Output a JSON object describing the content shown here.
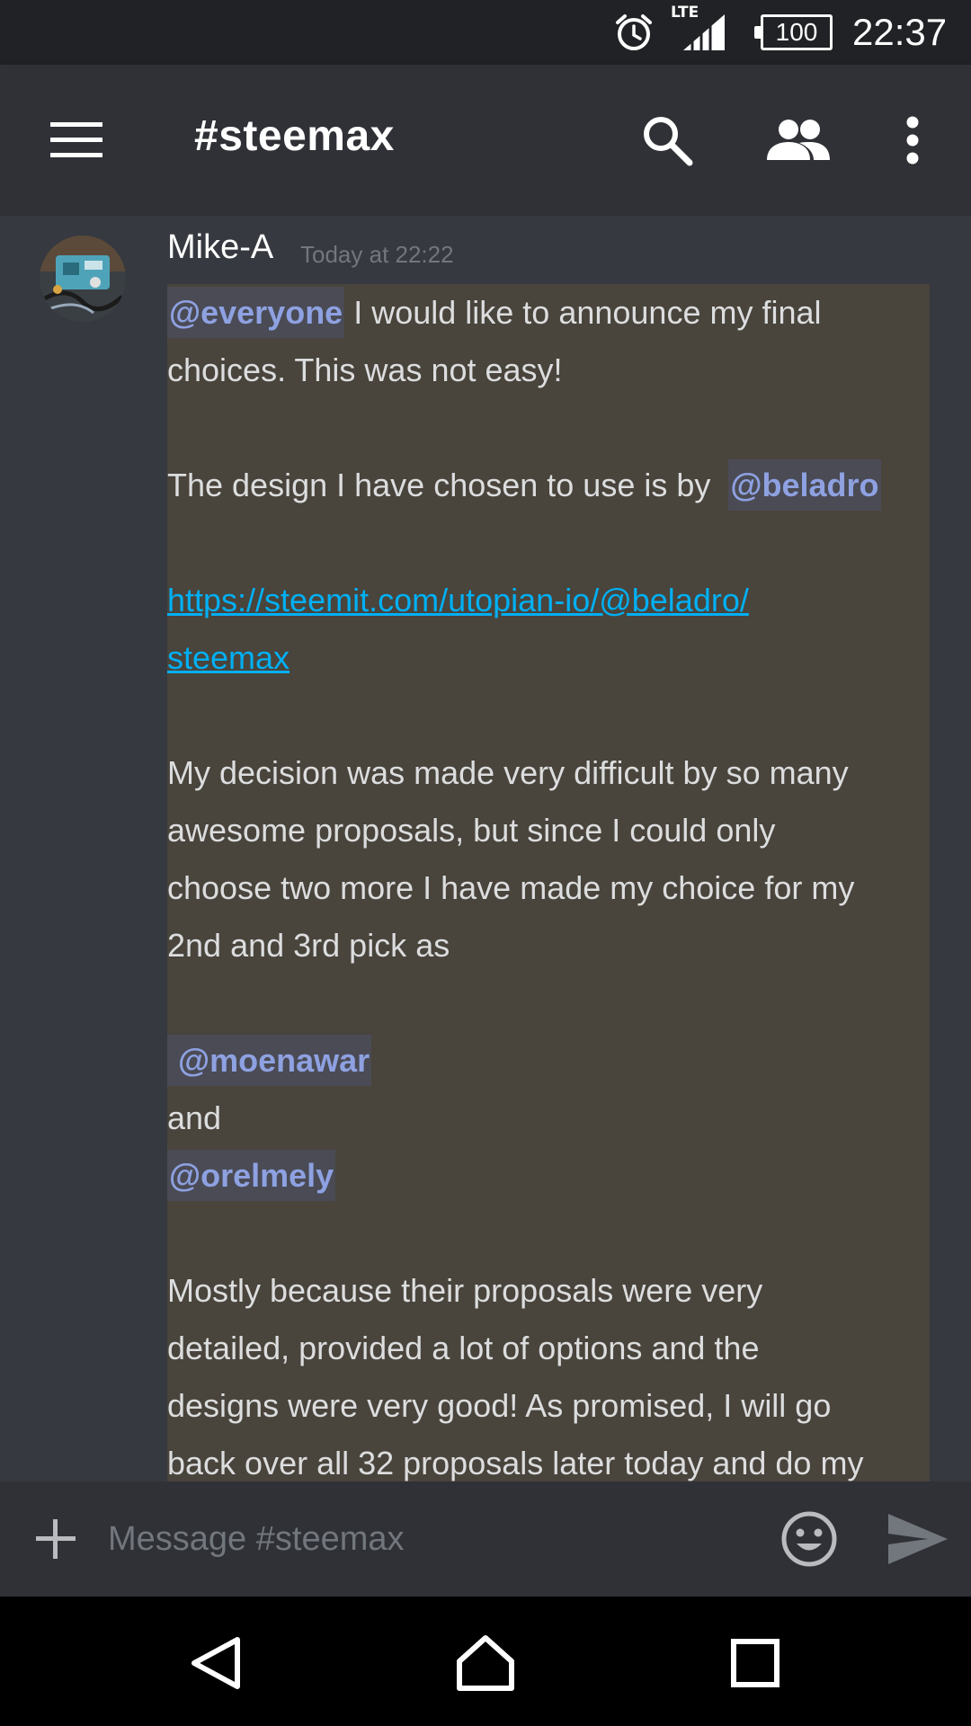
{
  "status_bar": {
    "network_label": "LTE",
    "battery_level": "100",
    "time": "22:37"
  },
  "header": {
    "channel_title": "#steemax"
  },
  "message": {
    "author": "Mike-A",
    "timestamp": "Today at 22:22",
    "lines": {
      "l1_mention": "@everyone",
      "l1_text": " I would like to announce my final",
      "l2": "choices. This was not easy!",
      "l4_text": "The design I have chosen to use is by  ",
      "l4_mention": "@beladro",
      "l6_link": "https://steemit.com/utopian-io/@beladro/",
      "l7_link": "steemax",
      "l9": "My decision was made very difficult by so many",
      "l10": "awesome proposals, but since I could only",
      "l11": "choose two more I have made my choice for my",
      "l12": "2nd and 3rd pick as",
      "l14_mention": " @moenawar",
      "l15": "and",
      "l16_mention": "@orelmely",
      "l18": "Mostly because their proposals were very",
      "l19": "detailed, provided a lot of options and the",
      "l20": "designs were very good! As promised, I will go",
      "l21": "back over all 32 proposals later today and do my"
    }
  },
  "composer": {
    "placeholder": "Message #steemax"
  },
  "colors": {
    "background": "#36393f",
    "header": "#2f3136",
    "status_bar": "#202225",
    "highlight": "#49443c",
    "mention": "#8ea1e1",
    "link": "#00b0f4"
  },
  "icons": {
    "status": [
      "alarm-clock-icon",
      "signal-icon",
      "battery-icon"
    ],
    "header": [
      "hamburger-menu-icon",
      "search-icon",
      "members-icon",
      "more-vertical-icon"
    ],
    "composer": [
      "plus-icon",
      "emoji-icon",
      "send-icon"
    ],
    "nav": [
      "back-triangle-icon",
      "home-icon",
      "recents-square-icon"
    ]
  }
}
